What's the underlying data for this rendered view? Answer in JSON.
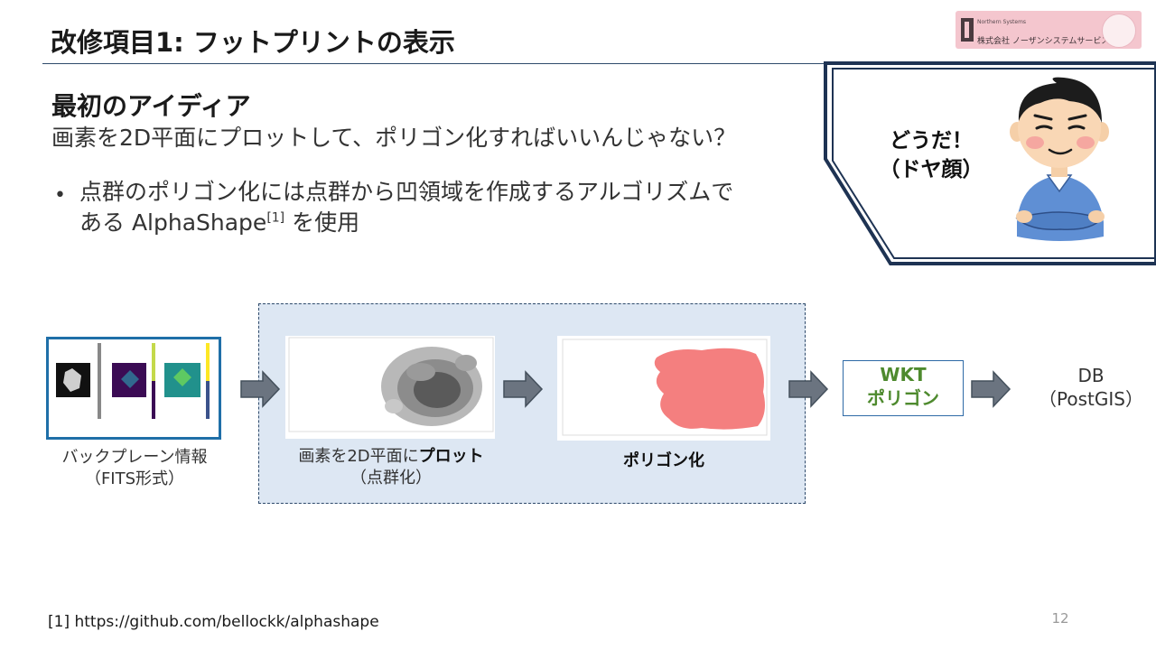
{
  "slide": {
    "title": "改修項目1: フットプリントの表示",
    "subhead": "最初のアイディア",
    "lead": "画素を2D平面にプロットして、ポリゴン化すればいいんじゃない？",
    "bullet_marker": "•",
    "bullet_text_a": "点群のポリゴン化には点群から凹領域を作成するアルゴリズムで",
    "bullet_text_b": "ある AlphaShape",
    "bullet_ref": "[1]",
    "bullet_text_c": " を使用",
    "footnote": "[1] https://github.com/bellockk/alphashape",
    "page_number": "12"
  },
  "logo": {
    "small_text": "Northern Systems",
    "company_name": "株式会社 ノーザンシステムサービス"
  },
  "callout": {
    "line1": "どうだ！",
    "line2": "（ドヤ顔）"
  },
  "flow": {
    "fits_caption_line1": "バックプレーン情報",
    "fits_caption_line2": "（FITS形式）",
    "plot_caption_prefix": "画素を2D平面に",
    "plot_caption_bold": "プロット",
    "plot_caption_line2": "（点群化）",
    "polygon_caption": "ポリゴン化",
    "wkt_line1": "WKT",
    "wkt_line2": "ポリゴン",
    "db_line1": "DB",
    "db_line2": "（PostGIS）"
  },
  "colors": {
    "title_rule": "#2e4a6b",
    "dash_box_fill": "#dde7f3",
    "fits_border": "#1f6fa8",
    "arrow_fill": "#6b7480",
    "wkt_text": "#4e8a2e",
    "polygon_fill": "#f47f7f"
  }
}
